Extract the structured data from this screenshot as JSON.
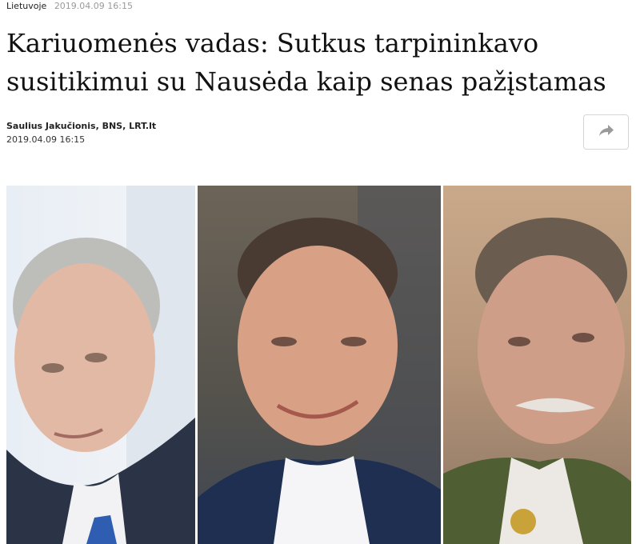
{
  "article": {
    "category": "Lietuvoje",
    "top_timestamp": "2019.04.09 16:15",
    "headline": "Kariuomenės vadas: Sutkus tarpininkavo susitikimui su Nausėda kaip senas pažįstamas",
    "author": "Saulius Jakučionis, BNS, LRT.lt",
    "date": "2019.04.09 16:15"
  },
  "share": {
    "icon": "share-arrow-icon"
  },
  "photos": [
    {
      "name": "portrait-left"
    },
    {
      "name": "portrait-center"
    },
    {
      "name": "portrait-right"
    }
  ]
}
